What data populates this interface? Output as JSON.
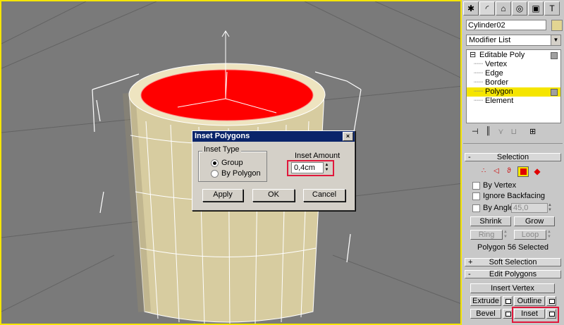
{
  "dialog": {
    "title": "Inset Polygons",
    "close_glyph": "×",
    "inset_type_label": "Inset Type",
    "radio_group": "Group",
    "radio_by_polygon": "By Polygon",
    "inset_amount_label": "Inset Amount",
    "inset_amount_value": "0,4cm",
    "apply": "Apply",
    "ok": "OK",
    "cancel": "Cancel"
  },
  "panel": {
    "tabs": [
      "create-icon",
      "modify-icon",
      "hierarchy-icon",
      "motion-icon",
      "display-icon",
      "utilities-icon"
    ],
    "object_name": "Cylinder02",
    "object_color": "#e2d592",
    "modifier_list": "Modifier List",
    "stack": {
      "base": "Editable Poly",
      "items": [
        "Vertex",
        "Edge",
        "Border",
        "Polygon",
        "Element"
      ],
      "selected": "Polygon"
    },
    "selection": {
      "header": "Selection",
      "by_vertex": "By Vertex",
      "ignore_backfacing": "Ignore Backfacing",
      "by_angle": "By Angle:",
      "angle_value": "45,0",
      "shrink": "Shrink",
      "grow": "Grow",
      "ring": "Ring",
      "loop": "Loop",
      "status": "Polygon 56 Selected"
    },
    "soft_selection": {
      "header": "Soft Selection"
    },
    "edit_polygons": {
      "header": "Edit Polygons",
      "insert_vertex": "Insert Vertex",
      "extrude": "Extrude",
      "outline": "Outline",
      "bevel": "Bevel",
      "inset": "Inset"
    }
  },
  "colors": {
    "viewport_border": "#f5e500",
    "selected_polygon": "#ff0000",
    "cylinder": "#d7cca0",
    "highlight_box": "#e0183c",
    "title_bar": "#0a246a"
  }
}
